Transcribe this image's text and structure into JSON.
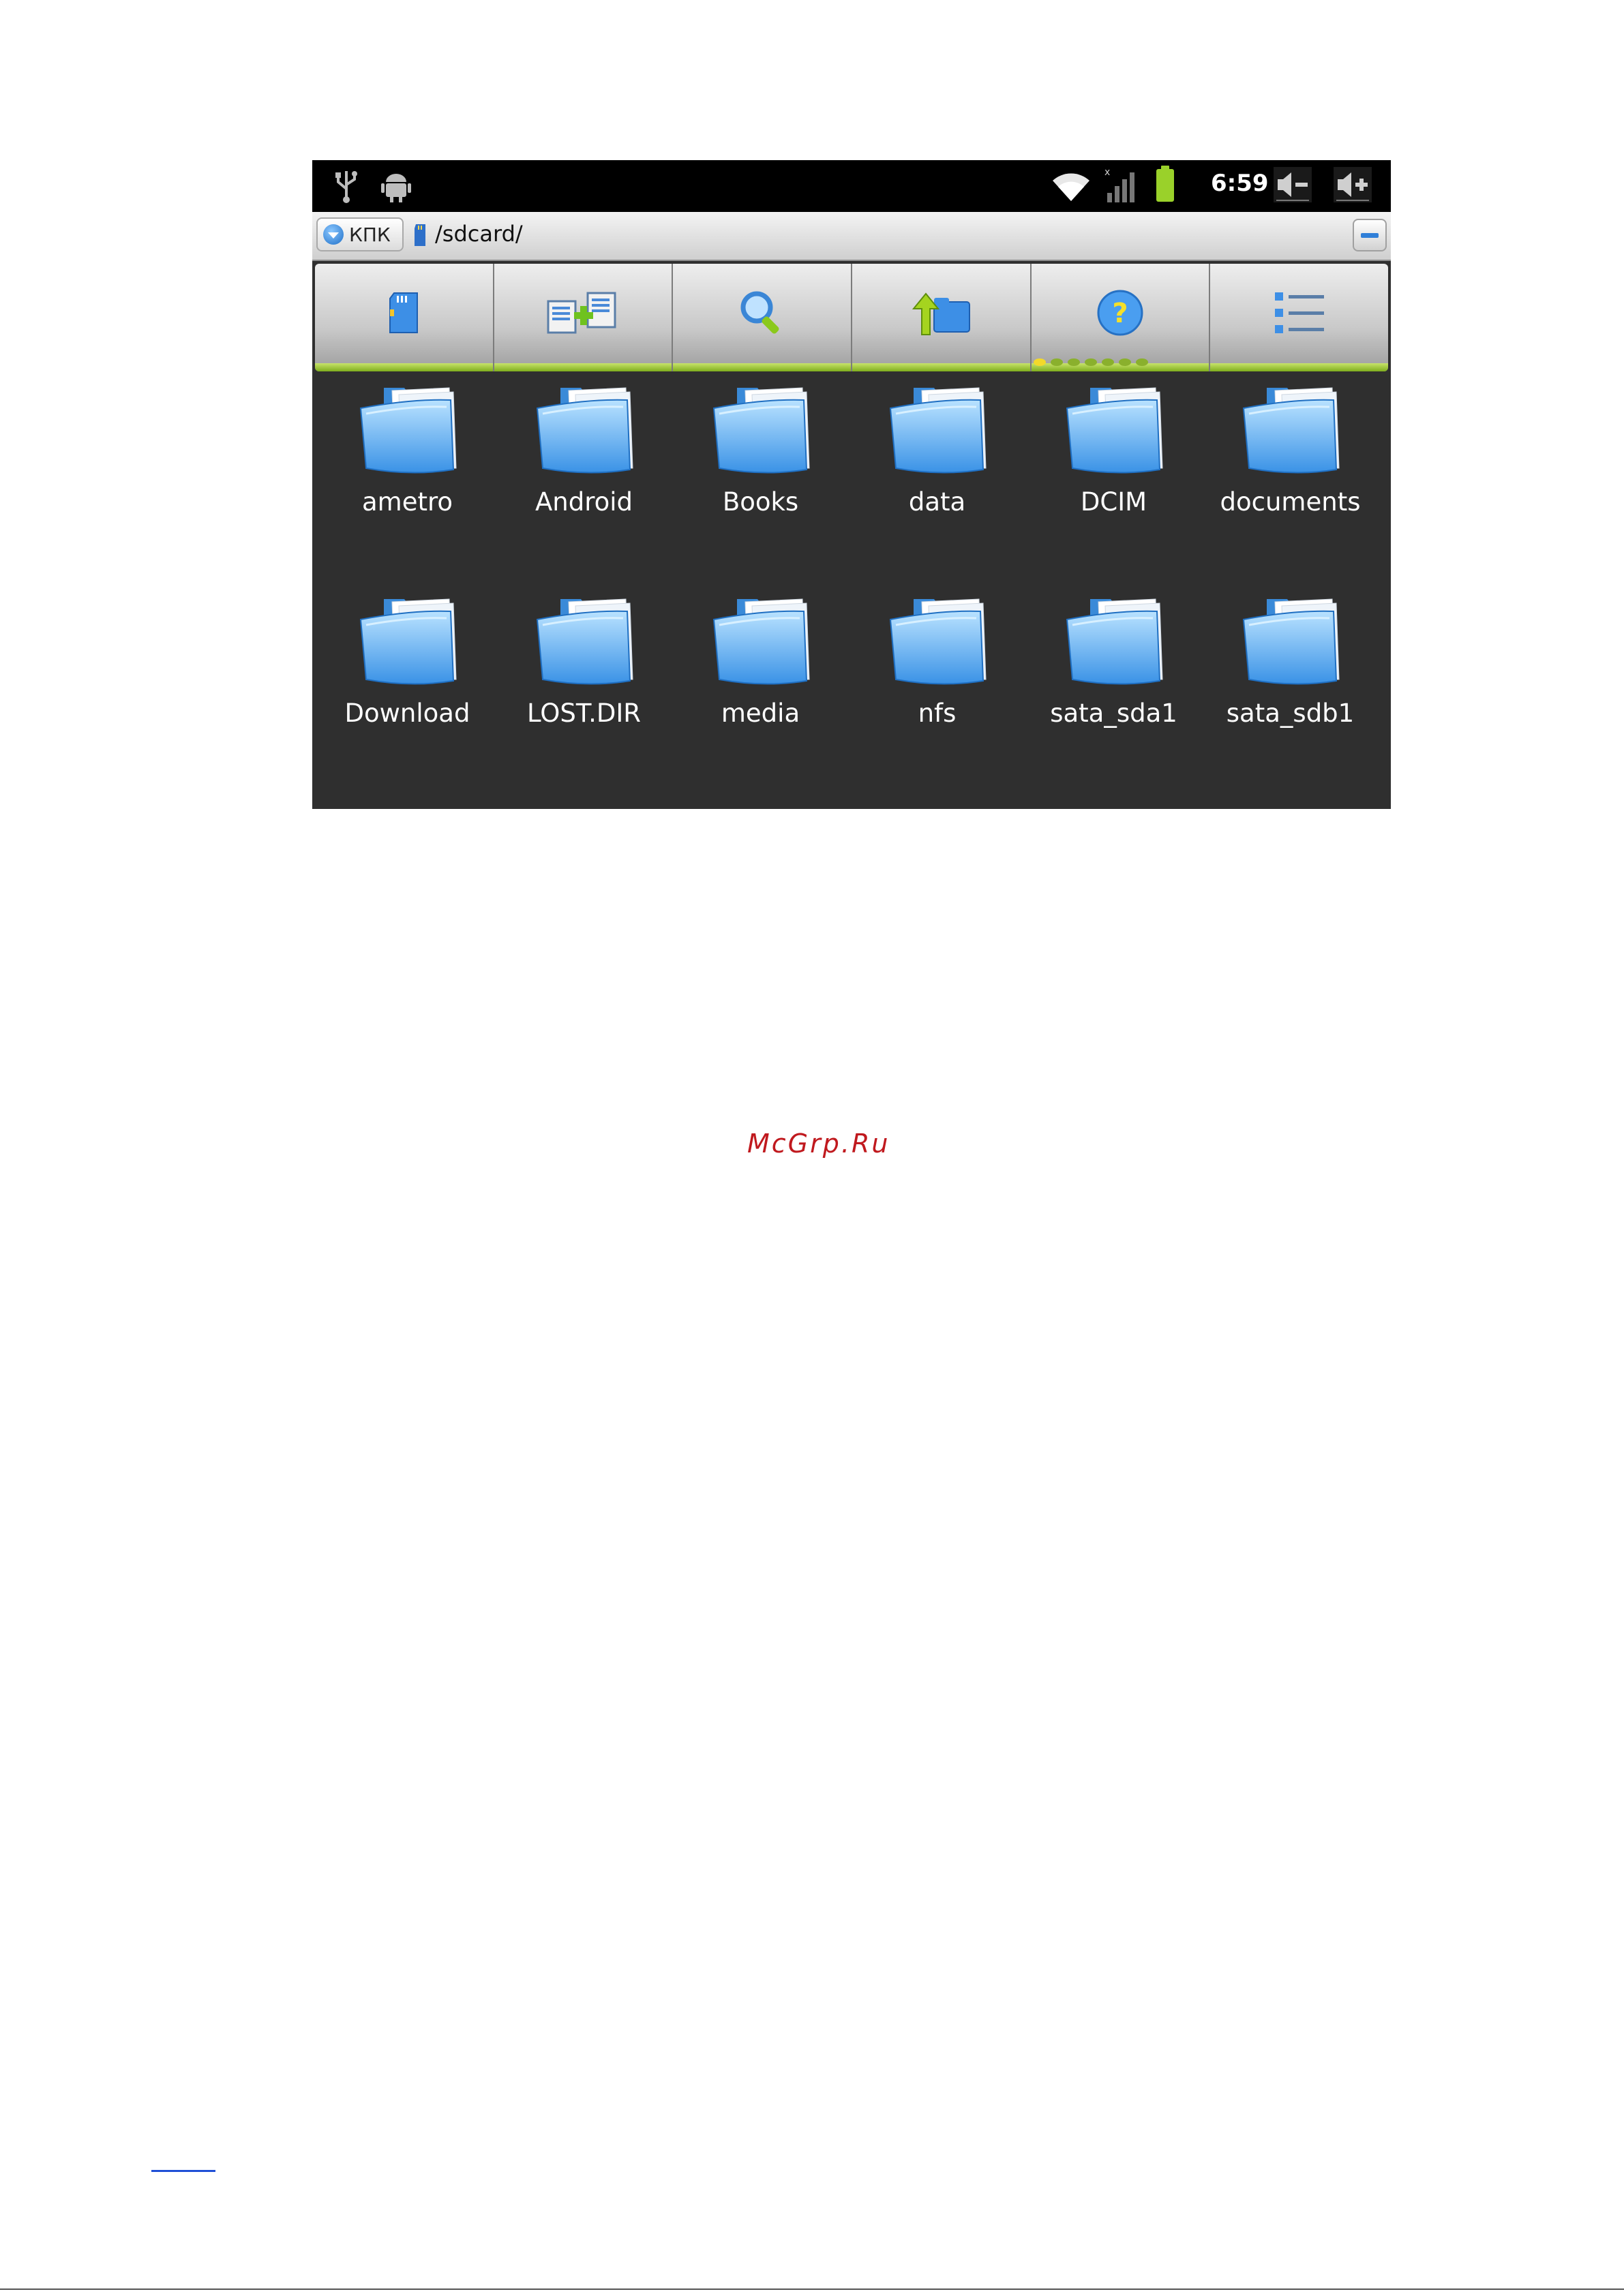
{
  "statusbar": {
    "left_icons": [
      "usb-icon",
      "android-debug-icon"
    ],
    "right_icons": [
      "wifi-icon",
      "signal-icon",
      "battery-icon",
      "volume-down-icon",
      "volume-up-icon"
    ],
    "time": "6:59"
  },
  "pathbar": {
    "storage_label": "КПК",
    "path": "/sdcard/"
  },
  "toolbar": {
    "buttons": [
      "sd-card-icon",
      "copy-files-icon",
      "search-icon",
      "up-folder-icon",
      "help-icon",
      "list-view-icon"
    ],
    "page_indicator": {
      "count": 7,
      "active_index": 0
    }
  },
  "files": [
    {
      "name": "ametro"
    },
    {
      "name": "Android"
    },
    {
      "name": "Books"
    },
    {
      "name": "data"
    },
    {
      "name": "DCIM"
    },
    {
      "name": "documents"
    },
    {
      "name": "Download"
    },
    {
      "name": "LOST.DIR"
    },
    {
      "name": "media"
    },
    {
      "name": "nfs"
    },
    {
      "name": "sata_sda1"
    },
    {
      "name": "sata_sdb1"
    }
  ],
  "watermark": "McGrp.Ru",
  "colors": {
    "accent_green": "#8ab02d",
    "folder_blue": "#4aa3ee",
    "watermark_red": "#c0191e",
    "background_dark": "#2f2f2f"
  }
}
